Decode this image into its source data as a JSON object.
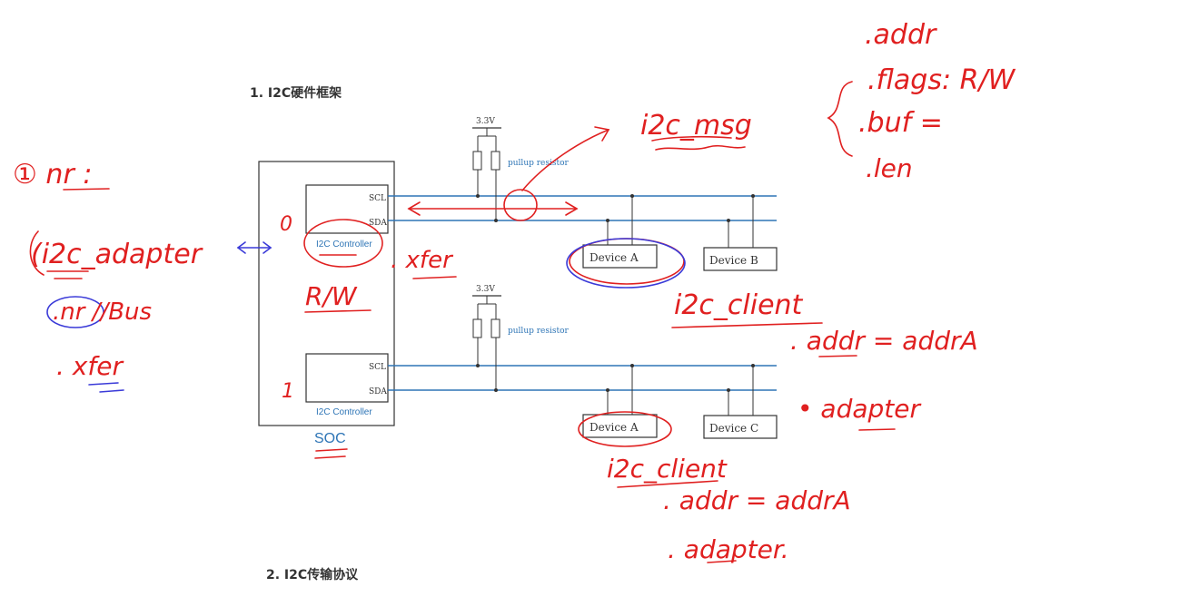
{
  "headings": {
    "h1": "1. I2C硬件框架",
    "h2": "2. I2C传输协议"
  },
  "diagram": {
    "soc_label": "SOC",
    "controller_label": "I2C Controller",
    "scl_label": "SCL",
    "sda_label": "SDA",
    "voltage_label": "3.3V",
    "pullup_label": "pullup resistor",
    "device_a": "Device A",
    "device_b": "Device B",
    "device_c": "Device C"
  },
  "annotations": {
    "bus0": "0",
    "bus1": "1",
    "nr_item": "① nr :",
    "i2c_adapter": "(i2c_adapter",
    "nr_bus": ".nr //Bus",
    "xfer_left": ". xfer",
    "xfer_mid": ". xfer",
    "rw": "R/W",
    "i2c_msg": "i2c_msg",
    "msg_addr": ".addr",
    "msg_flags": ".flags: R/W",
    "msg_buf": ".buf =",
    "msg_len": ".len",
    "client1": "i2c_client",
    "client1_addr": ". addr = addrA",
    "client1_adapter": "• adapter",
    "client2": "i2c_client",
    "client2_addr": ". addr = addrA",
    "client2_adapter": ". adapter."
  },
  "colors": {
    "line_blue": "#2e75b6",
    "ink_red": "#e02020",
    "ink_blue": "#3a3ad8",
    "frame": "#333333"
  }
}
